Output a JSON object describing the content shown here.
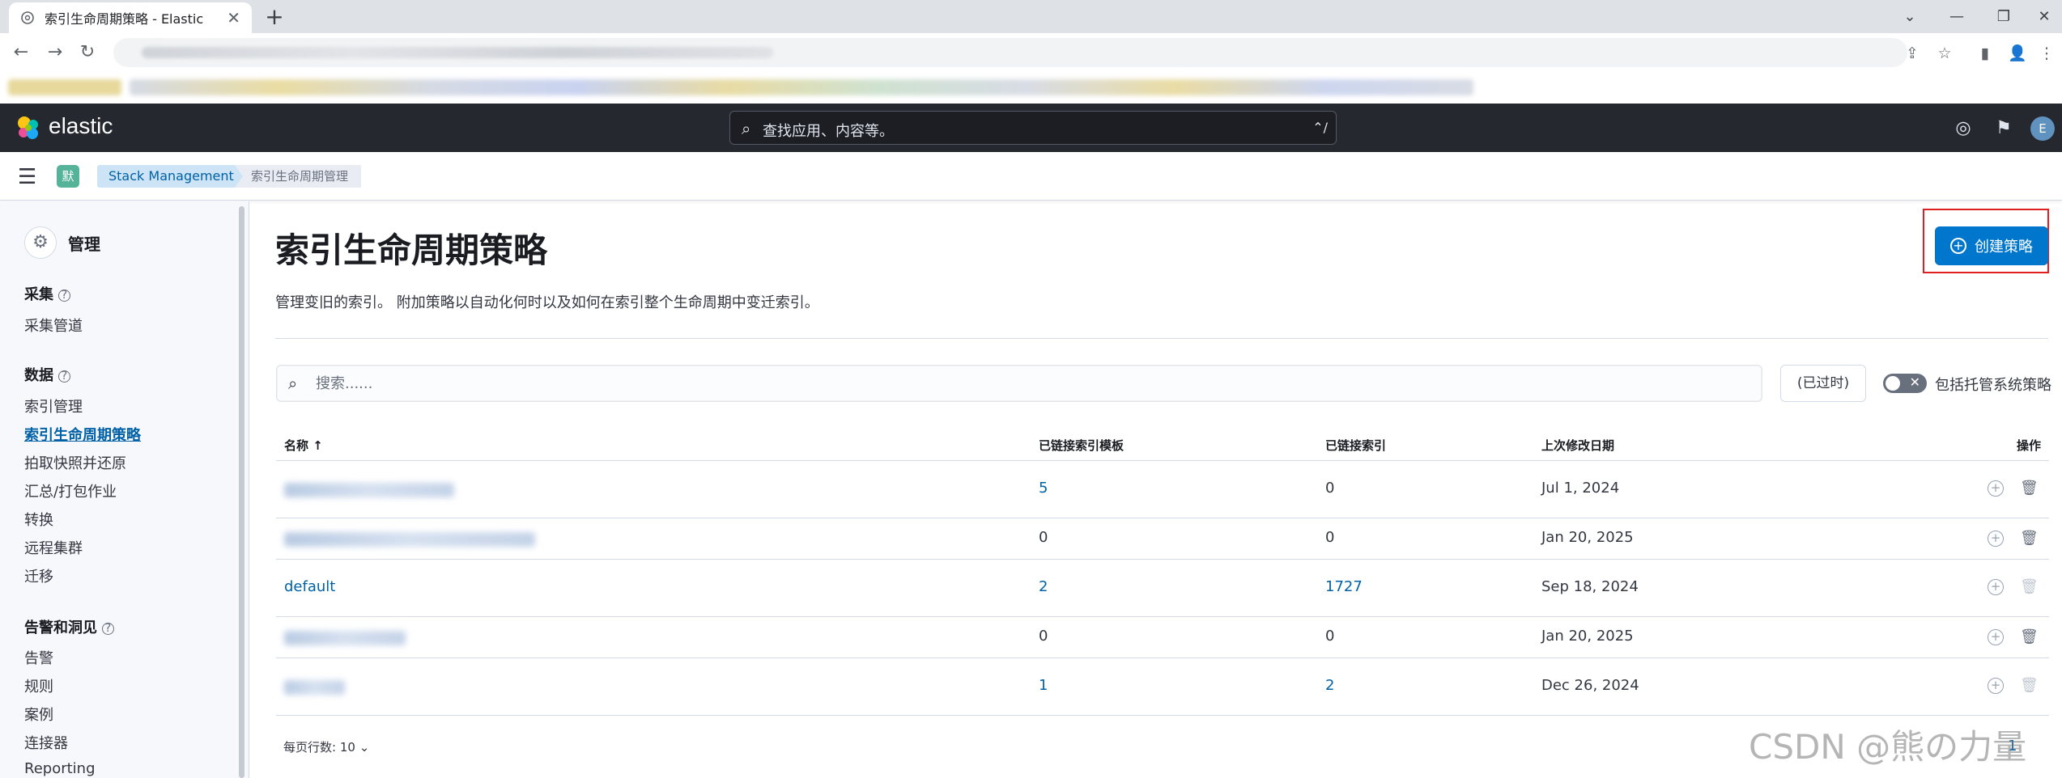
{
  "browser": {
    "tab_title": "索引生命周期策略 - Elastic",
    "tab_close": "✕",
    "new_tab": "+"
  },
  "header": {
    "brand": "elastic",
    "search_placeholder": "查找应用、内容等。",
    "search_shortcut": "⌃/",
    "avatar": "E"
  },
  "breadcrumbs": {
    "space_badge": "默",
    "items": [
      "Stack Management",
      "索引生命周期管理"
    ]
  },
  "sidebar": {
    "title": "管理",
    "groups": [
      {
        "label": "采集",
        "items": [
          "采集管道"
        ]
      },
      {
        "label": "数据",
        "items": [
          "索引管理",
          "索引生命周期策略",
          "拍取快照并还原",
          "汇总/打包作业",
          "转换",
          "远程集群",
          "迁移"
        ]
      },
      {
        "label": "告警和洞见",
        "items": [
          "告警",
          "规则",
          "案例",
          "连接器",
          "Reporting"
        ]
      }
    ],
    "active_item": "索引生命周期策略"
  },
  "main": {
    "title": "索引生命周期策略",
    "description": "管理变旧的索引。 附加策略以自动化何时以及如何在索引整个生命周期中变迁索引。",
    "create_button": "创建策略",
    "search_placeholder": "搜索......",
    "deprecated_filter": "(已过时)",
    "toggle_label": "包括托管系统策略",
    "table": {
      "columns": [
        "名称 ↑",
        "已链接索引模板",
        "已链接索引",
        "上次修改日期",
        "操作"
      ],
      "rows": [
        {
          "name": "",
          "templates": "5",
          "indices": "0",
          "modified": "Jul 1, 2024",
          "delete_enabled": true
        },
        {
          "name": "",
          "templates": "0",
          "indices": "0",
          "modified": "Jan 20, 2025",
          "delete_enabled": true
        },
        {
          "name": "default",
          "templates": "2",
          "indices": "1727",
          "modified": "Sep 18, 2024",
          "delete_enabled": false
        },
        {
          "name": "",
          "templates": "0",
          "indices": "0",
          "modified": "Jan 20, 2025",
          "delete_enabled": true
        },
        {
          "name": "",
          "templates": "1",
          "indices": "2",
          "modified": "Dec 26, 2024",
          "delete_enabled": false
        }
      ]
    },
    "pager": {
      "rows_per_page": "每页行数: 10",
      "page": "1"
    }
  },
  "watermark": "CSDN @熊の力量",
  "colors": {
    "primary": "#0077cc",
    "header_bg": "#25282f",
    "link": "#0061a6",
    "highlight": "#e02020"
  }
}
